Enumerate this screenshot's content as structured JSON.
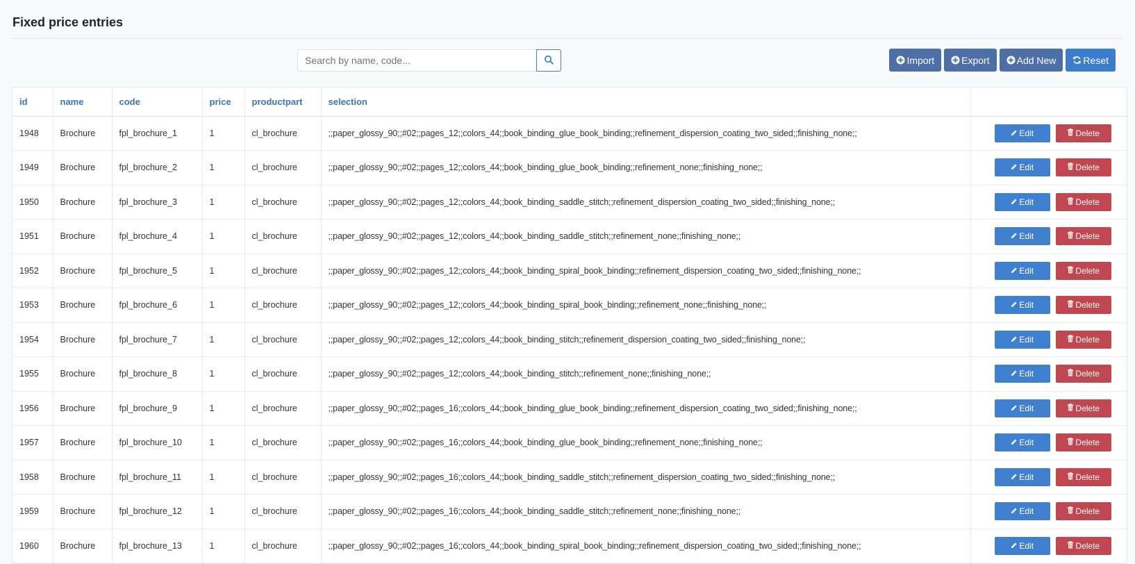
{
  "page": {
    "title": "Fixed price entries"
  },
  "search": {
    "placeholder": "Search by name, code..."
  },
  "toolbar": {
    "import_label": "Import",
    "export_label": "Export",
    "add_label": "Add New",
    "reset_label": "Reset"
  },
  "table": {
    "columns": [
      "id",
      "name",
      "code",
      "price",
      "productpart",
      "selection",
      ""
    ],
    "edit_label": "Edit",
    "delete_label": "Delete",
    "rows": [
      {
        "id": "1948",
        "name": "Brochure",
        "code": "fpl_brochure_1",
        "price": "1",
        "productpart": "cl_brochure",
        "selection": ";;paper_glossy_90;;#02;;pages_12;;colors_44;;book_binding_glue_book_binding;;refinement_dispersion_coating_two_sided;;finishing_none;;"
      },
      {
        "id": "1949",
        "name": "Brochure",
        "code": "fpl_brochure_2",
        "price": "1",
        "productpart": "cl_brochure",
        "selection": ";;paper_glossy_90;;#02;;pages_12;;colors_44;;book_binding_glue_book_binding;;refinement_none;;finishing_none;;"
      },
      {
        "id": "1950",
        "name": "Brochure",
        "code": "fpl_brochure_3",
        "price": "1",
        "productpart": "cl_brochure",
        "selection": ";;paper_glossy_90;;#02;;pages_12;;colors_44;;book_binding_saddle_stitch;;refinement_dispersion_coating_two_sided;;finishing_none;;"
      },
      {
        "id": "1951",
        "name": "Brochure",
        "code": "fpl_brochure_4",
        "price": "1",
        "productpart": "cl_brochure",
        "selection": ";;paper_glossy_90;;#02;;pages_12;;colors_44;;book_binding_saddle_stitch;;refinement_none;;finishing_none;;"
      },
      {
        "id": "1952",
        "name": "Brochure",
        "code": "fpl_brochure_5",
        "price": "1",
        "productpart": "cl_brochure",
        "selection": ";;paper_glossy_90;;#02;;pages_12;;colors_44;;book_binding_spiral_book_binding;;refinement_dispersion_coating_two_sided;;finishing_none;;"
      },
      {
        "id": "1953",
        "name": "Brochure",
        "code": "fpl_brochure_6",
        "price": "1",
        "productpart": "cl_brochure",
        "selection": ";;paper_glossy_90;;#02;;pages_12;;colors_44;;book_binding_spiral_book_binding;;refinement_none;;finishing_none;;"
      },
      {
        "id": "1954",
        "name": "Brochure",
        "code": "fpl_brochure_7",
        "price": "1",
        "productpart": "cl_brochure",
        "selection": ";;paper_glossy_90;;#02;;pages_12;;colors_44;;book_binding_stitch;;refinement_dispersion_coating_two_sided;;finishing_none;;"
      },
      {
        "id": "1955",
        "name": "Brochure",
        "code": "fpl_brochure_8",
        "price": "1",
        "productpart": "cl_brochure",
        "selection": ";;paper_glossy_90;;#02;;pages_12;;colors_44;;book_binding_stitch;;refinement_none;;finishing_none;;"
      },
      {
        "id": "1956",
        "name": "Brochure",
        "code": "fpl_brochure_9",
        "price": "1",
        "productpart": "cl_brochure",
        "selection": ";;paper_glossy_90;;#02;;pages_16;;colors_44;;book_binding_glue_book_binding;;refinement_dispersion_coating_two_sided;;finishing_none;;"
      },
      {
        "id": "1957",
        "name": "Brochure",
        "code": "fpl_brochure_10",
        "price": "1",
        "productpart": "cl_brochure",
        "selection": ";;paper_glossy_90;;#02;;pages_16;;colors_44;;book_binding_glue_book_binding;;refinement_none;;finishing_none;;"
      },
      {
        "id": "1958",
        "name": "Brochure",
        "code": "fpl_brochure_11",
        "price": "1",
        "productpart": "cl_brochure",
        "selection": ";;paper_glossy_90;;#02;;pages_16;;colors_44;;book_binding_saddle_stitch;;refinement_dispersion_coating_two_sided;;finishing_none;;"
      },
      {
        "id": "1959",
        "name": "Brochure",
        "code": "fpl_brochure_12",
        "price": "1",
        "productpart": "cl_brochure",
        "selection": ";;paper_glossy_90;;#02;;pages_16;;colors_44;;book_binding_saddle_stitch;;refinement_none;;finishing_none;;"
      },
      {
        "id": "1960",
        "name": "Brochure",
        "code": "fpl_brochure_13",
        "price": "1",
        "productpart": "cl_brochure",
        "selection": ";;paper_glossy_90;;#02;;pages_16;;colors_44;;book_binding_spiral_book_binding;;refinement_dispersion_coating_two_sided;;finishing_none;;"
      }
    ]
  },
  "icons": {
    "search": "search-icon",
    "import": "plus-circle-icon",
    "export": "plus-circle-icon",
    "add": "plus-circle-icon",
    "reset": "refresh-icon",
    "edit": "pencil-icon",
    "delete": "trash-icon"
  },
  "colors": {
    "primary": "#3f7fd0",
    "toolbar_button": "#4b6fa6",
    "danger": "#c0464f",
    "header_text": "#3b74b9"
  }
}
